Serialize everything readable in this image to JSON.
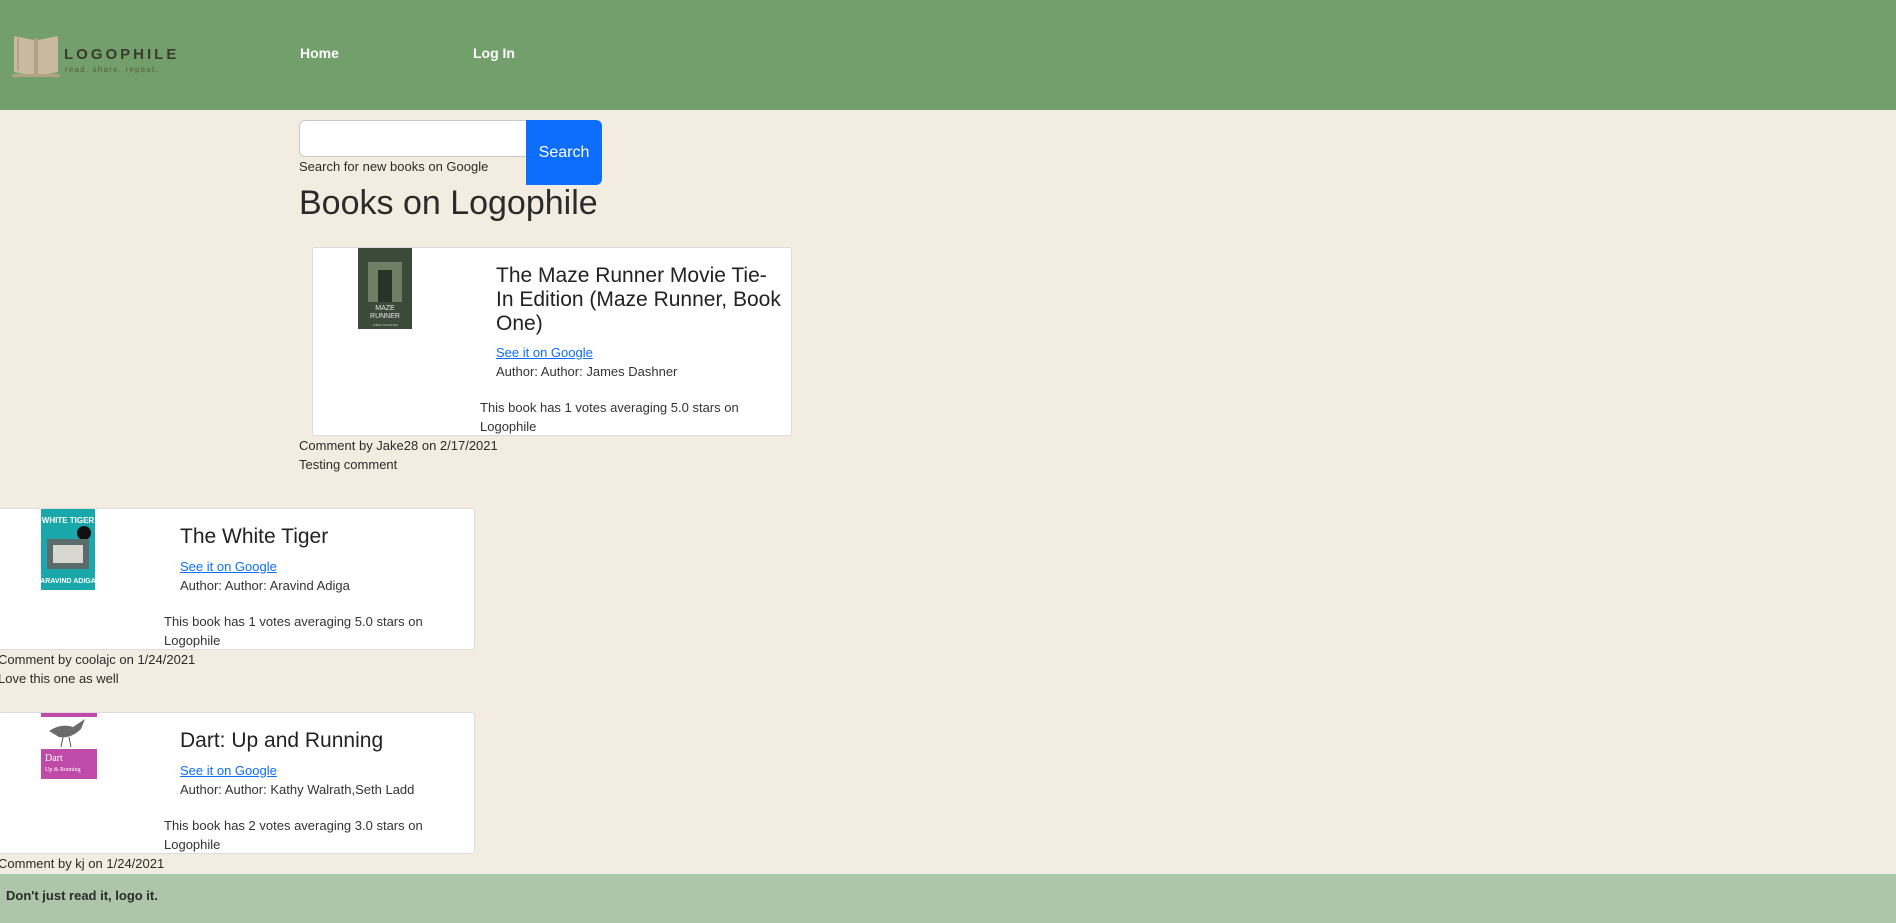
{
  "brand": {
    "name": "LOGOPHILE",
    "tagline": "read. share. repeat."
  },
  "nav": {
    "home": "Home",
    "login": "Log In"
  },
  "search": {
    "value": "",
    "placeholder": "",
    "button": "Search",
    "hint": "Search for new books on Google"
  },
  "page_title": "Books on Logophile",
  "books": [
    {
      "title": "The Maze Runner Movie Tie-In Edition (Maze Runner, Book One)",
      "link": "See it on Google",
      "author": "Author: Author: James Dashner",
      "votes": "This book has 1 votes averaging 5.0 stars on Logophile",
      "comment_meta": "Comment by Jake28 on 2/17/2021",
      "comment_text": "Testing comment",
      "cover_text": "MAZE RUNNER",
      "cover_color": "#3c4a3a"
    },
    {
      "title": "The White Tiger",
      "link": "See it on Google",
      "author": "Author: Author: Aravind Adiga",
      "votes": "This book has 1 votes averaging 5.0 stars on Logophile",
      "comment_meta": "Comment by coolajc on 1/24/2021",
      "comment_text": "Love this one as well",
      "cover_text": "WHITE TIGER",
      "cover_color": "#1aa7a9"
    },
    {
      "title": "Dart: Up and Running",
      "link": "See it on Google",
      "author": "Author: Author: Kathy Walrath,Seth Ladd",
      "votes": "This book has 2 votes averaging 3.0 stars on Logophile",
      "comment_meta": "Comment by kj on 1/24/2021",
      "cover_text": "Dart Up & Running",
      "cover_color": "#c04aa8"
    }
  ],
  "footer": "Don't just read it, logo it.",
  "colors": {
    "header": "#729f6b",
    "background": "#f3ece1",
    "footer": "#adc6aa",
    "accent": "#0d6efd"
  }
}
